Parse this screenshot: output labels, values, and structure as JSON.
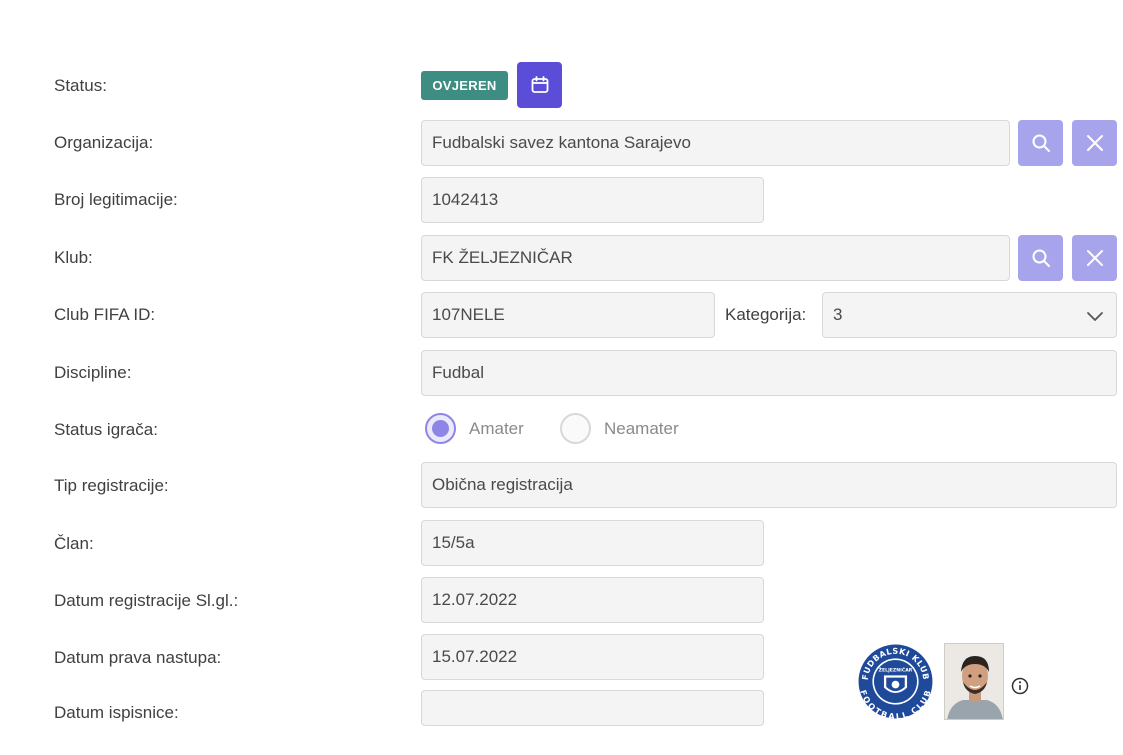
{
  "status": {
    "label": "Status:",
    "badge": "OVJEREN",
    "calendar_icon": "calendar-icon"
  },
  "organizacija": {
    "label": "Organizacija:",
    "value": "Fudbalski savez kantona Sarajevo",
    "search_icon": "search-icon",
    "clear_icon": "close-icon"
  },
  "broj_legitimacije": {
    "label": "Broj legitimacije:",
    "value": "1042413"
  },
  "klub": {
    "label": "Klub:",
    "value": "FK ŽELJEZNIČAR",
    "search_icon": "search-icon",
    "clear_icon": "close-icon"
  },
  "club_fifa_id": {
    "label": "Club FIFA ID:",
    "value": "107NELE"
  },
  "kategorija": {
    "label": "Kategorija:",
    "value": "3"
  },
  "discipline": {
    "label": "Discipline:",
    "value": "Fudbal"
  },
  "status_igraca": {
    "label": "Status igrača:",
    "options": [
      {
        "label": "Amater",
        "selected": true
      },
      {
        "label": "Neamater",
        "selected": false
      }
    ]
  },
  "tip_registracije": {
    "label": "Tip registracije:",
    "value": "Obična registracija"
  },
  "clan": {
    "label": "Član:",
    "value": "15/5a"
  },
  "datum_registracije": {
    "label": "Datum registracije Sl.gl.:",
    "value": "12.07.2022"
  },
  "datum_prava_nastupa": {
    "label": "Datum prava nastupa:",
    "value": "15.07.2022"
  },
  "datum_ispisnice": {
    "label": "Datum ispisnice:",
    "value": ""
  },
  "colors": {
    "badge": "#3d8d82",
    "primary": "#5b4dd8",
    "icon_button": "#a8a4ec",
    "radio_selected": "#8e86e6",
    "field_bg": "#f4f4f4"
  },
  "club_logo": {
    "ring_text_top": "FUDBALSKI KLUB",
    "ring_text_bottom": "FOOTBALL CLUB",
    "center_text": "ŽELJEZNIČAR"
  }
}
